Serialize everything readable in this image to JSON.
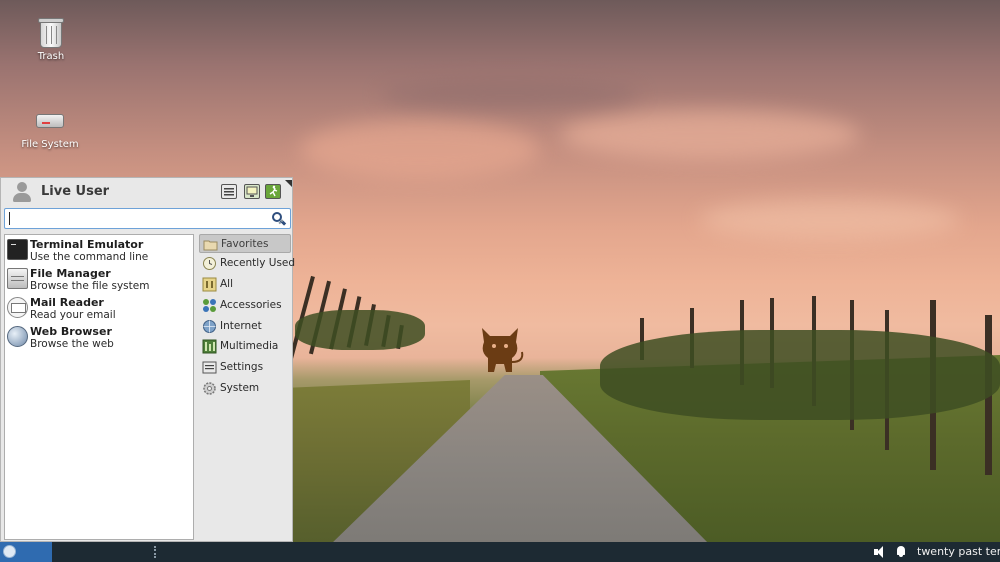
{
  "desktop": {
    "icons": [
      {
        "label": "Trash",
        "icon": "trash-icon"
      },
      {
        "label": "File System",
        "icon": "drive-icon"
      }
    ]
  },
  "menu": {
    "user_name": "Live User",
    "header_buttons": [
      "settings-icon",
      "lock-screen-icon",
      "log-out-icon"
    ],
    "search": {
      "value": "",
      "placeholder": ""
    },
    "apps": [
      {
        "name": "Terminal Emulator",
        "description": "Use the command line",
        "icon": "terminal-icon"
      },
      {
        "name": "File Manager",
        "description": "Browse the file system",
        "icon": "file-manager-icon"
      },
      {
        "name": "Mail Reader",
        "description": "Read your email",
        "icon": "mail-icon"
      },
      {
        "name": "Web Browser",
        "description": "Browse the web",
        "icon": "globe-icon"
      }
    ],
    "categories": [
      {
        "label": "Favorites",
        "icon": "folder-icon",
        "selected": true
      },
      {
        "label": "Recently Used",
        "icon": "clock-icon",
        "selected": false
      },
      {
        "label": "All",
        "icon": "all-apps-icon",
        "selected": false
      },
      {
        "label": "Accessories",
        "icon": "accessories-icon",
        "selected": false
      },
      {
        "label": "Internet",
        "icon": "globe-icon",
        "selected": false
      },
      {
        "label": "Multimedia",
        "icon": "multimedia-icon",
        "selected": false
      },
      {
        "label": "Settings",
        "icon": "settings-icon",
        "selected": false
      },
      {
        "label": "System",
        "icon": "gear-icon",
        "selected": false
      }
    ]
  },
  "panel": {
    "clock": "twenty past ten",
    "tray_icons": [
      "volume-icon",
      "notification-bell-icon"
    ]
  },
  "colors": {
    "panel_bg": "#1d2a33",
    "menu_button": "#2f6bb0",
    "menu_bg": "#e8e8e8",
    "selected_category": "#c8c8c8"
  }
}
